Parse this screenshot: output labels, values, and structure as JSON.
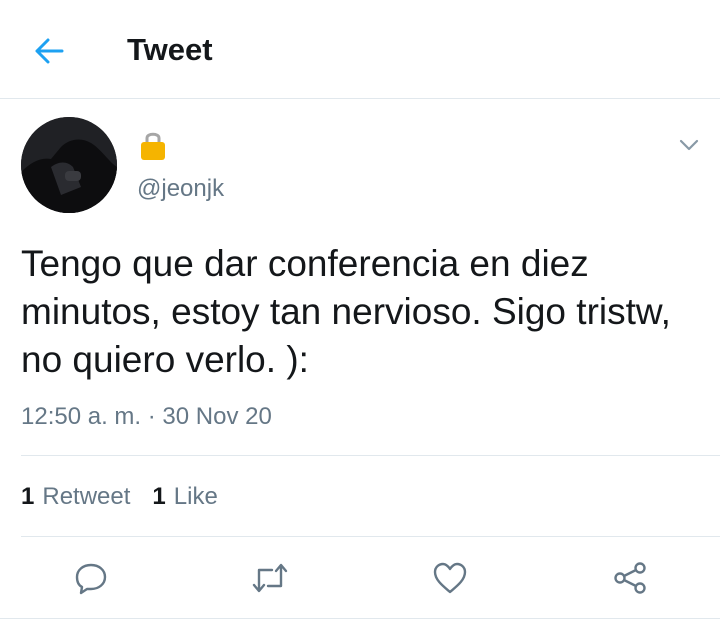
{
  "header": {
    "title": "Tweet",
    "back_icon": "arrow-left-icon",
    "accent_color": "#1da1f2"
  },
  "author": {
    "name_icon": "lock-icon",
    "handle": "@jeonjk"
  },
  "tweet": {
    "text": "Tengo que dar conferencia en diez minutos, estoy tan nervioso. Sigo tristw, no quiero verlo. ):",
    "timestamp": "12:50 a. m. · 30 Nov 20"
  },
  "stats": {
    "retweets_count": "1",
    "retweets_label": "Retweet",
    "likes_count": "1",
    "likes_label": "Like"
  },
  "actions": [
    "reply-icon",
    "retweet-icon",
    "like-icon",
    "share-icon"
  ],
  "colors": {
    "text_primary": "#14171a",
    "text_secondary": "#657786",
    "divider": "#e1e8ed",
    "lock": "#f5b400"
  }
}
